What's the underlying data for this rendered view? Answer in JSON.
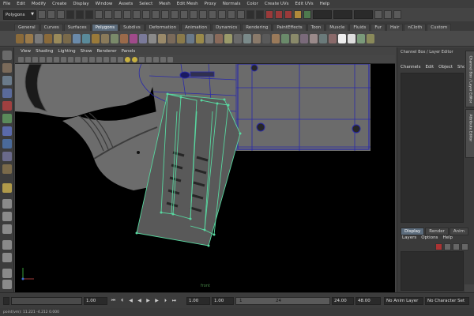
{
  "menubar": [
    "File",
    "Edit",
    "Modify",
    "Create",
    "Display",
    "Window",
    "Assets",
    "Select",
    "Mesh",
    "Edit Mesh",
    "Proxy",
    "Normals",
    "Color",
    "Create UVs",
    "Edit UVs",
    "Help"
  ],
  "status": {
    "mode": "Polygons"
  },
  "shelf": {
    "tabs": [
      "General",
      "Curves",
      "Surfaces",
      "Polygons",
      "Subdivs",
      "Deformation",
      "Animation",
      "Dynamics",
      "Rendering",
      "PaintEffects",
      "Toon",
      "Muscle",
      "Fluids",
      "Fur",
      "Hair",
      "nCloth",
      "Custom"
    ],
    "active": "Polygons"
  },
  "viewport": {
    "menu": [
      "View",
      "Shading",
      "Lighting",
      "Show",
      "Renderer",
      "Panels"
    ],
    "camera_label": "front"
  },
  "channel_box": {
    "title": "Channel Box / Layer Editor",
    "menu": [
      "Channels",
      "Edit",
      "Object",
      "Show"
    ]
  },
  "side_tabs": [
    "Channel Box / Layer Editor",
    "Attribute Editor"
  ],
  "layer_editor": {
    "tabs": [
      "Display",
      "Render",
      "Anim"
    ],
    "active": "Display",
    "menu": [
      "Layers",
      "Options",
      "Help"
    ]
  },
  "timeline": {
    "start": "1.00",
    "current_left": "1.00",
    "field_a": "1.00",
    "range_start": "1.00",
    "range_first": "1",
    "range_last": "24",
    "end": "24.00",
    "playback_end": "48.00",
    "anim_layer": "No Anim Layer",
    "character_set": "No Character Set"
  },
  "cmdline": {
    "text": "point(vm): 11.221  -4.212  0.000"
  },
  "colors": {
    "wire": "#2020a0",
    "selection": "#58d8a0",
    "active_tab": "#5b6b7b"
  }
}
